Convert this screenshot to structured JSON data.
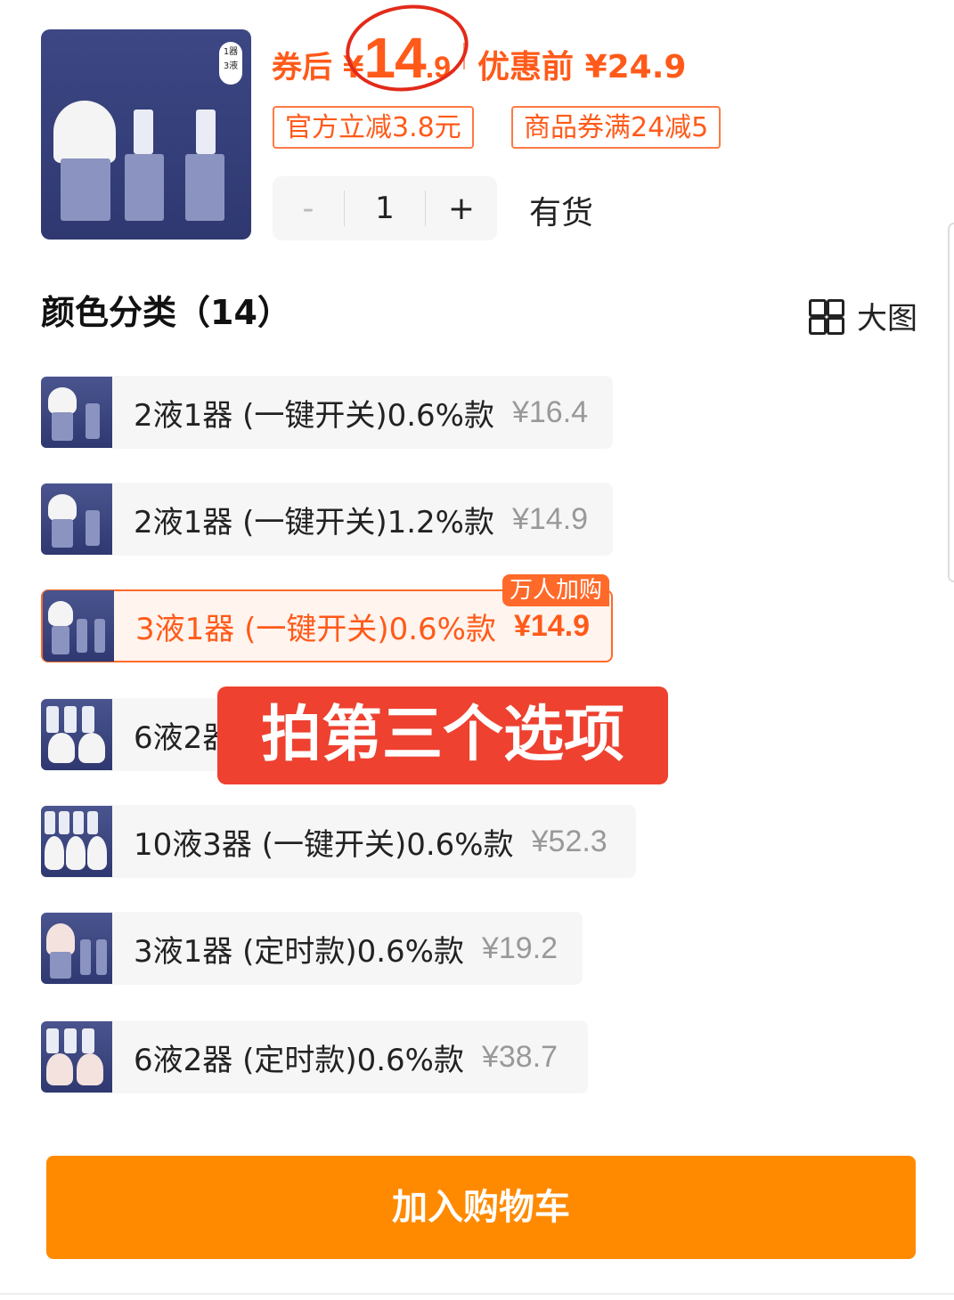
{
  "product": {
    "badge_line1": "1器",
    "badge_line2": "3液"
  },
  "price": {
    "prefix": "券后 ¥",
    "big": "14",
    "small": ".9",
    "orig_label": "优惠前 ¥24.9"
  },
  "coupons": [
    "官方立减3.8元",
    "商品券满24减5"
  ],
  "stepper": {
    "minus": "-",
    "value": "1",
    "plus": "+"
  },
  "stock": "有货",
  "section_title": "颜色分类（14）",
  "big_image_label": "大图",
  "options": [
    {
      "label": "2液1器 (一键开关)0.6%款",
      "price": "¥16.4"
    },
    {
      "label": "2液1器 (一键开关)1.2%款",
      "price": "¥14.9"
    },
    {
      "label": "3液1器 (一键开关)0.6%款",
      "price": "¥14.9",
      "tag": "万人加购"
    },
    {
      "label": "6液2器 (一键开关)0.6%款",
      "price": ""
    },
    {
      "label": "10液3器 (一键开关)0.6%款",
      "price": "¥52.3"
    },
    {
      "label": "3液1器 (定时款)0.6%款",
      "price": "¥19.2"
    },
    {
      "label": "6液2器 (定时款)0.6%款",
      "price": "¥38.7"
    }
  ],
  "overlay_text": "拍第三个选项",
  "cart_button": "加入购物车",
  "colors": {
    "accent": "#ff5a1a",
    "cart": "#ff8a00",
    "overlay": "#ee4130"
  }
}
